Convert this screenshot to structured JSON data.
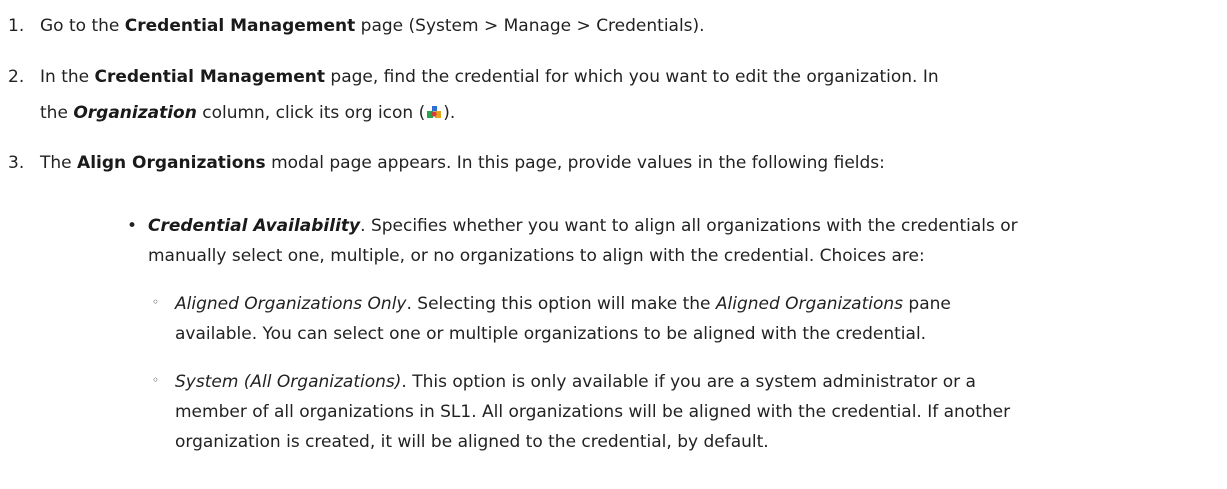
{
  "steps": [
    {
      "number": "1.",
      "t1": "Go to the ",
      "b1": "Credential Management",
      "t2": " page (System > Manage > Credentials)."
    },
    {
      "number": "2.",
      "t1": "In the ",
      "b1": "Credential Management",
      "t2": " page, find the credential for which you want to edit the organization. In",
      "l2a": "the ",
      "bi": "Organization",
      "l2b": " column, click its org icon (",
      "l2c": ")."
    },
    {
      "number": "3.",
      "t1": "The ",
      "b1": "Align Organizations",
      "t2": " modal page appears. In this page, provide values in the following fields:"
    }
  ],
  "bullet": {
    "marker": "•",
    "field": "Credential Availability",
    "line1": ". Specifies whether you want to align all organizations with the credentials or",
    "line2": "manually select one, multiple, or no organizations to align with the credential. Choices are:"
  },
  "choices": [
    {
      "marker": "◦",
      "name": "Aligned Organizations Only",
      "line1a": ". Selecting this option will make the ",
      "line1i": "Aligned Organizations",
      "line1b": " pane",
      "line2": "available. You can select one or multiple organizations to be aligned with the credential."
    },
    {
      "marker": "◦",
      "name": "System (All Organizations)",
      "line1": ". This option is only available if you are a system administrator or a",
      "line2": "member of all organizations in SL1. All organizations will be aligned with the credential. If another",
      "line3": "organization is created, it will be aligned to the credential, by default."
    }
  ]
}
